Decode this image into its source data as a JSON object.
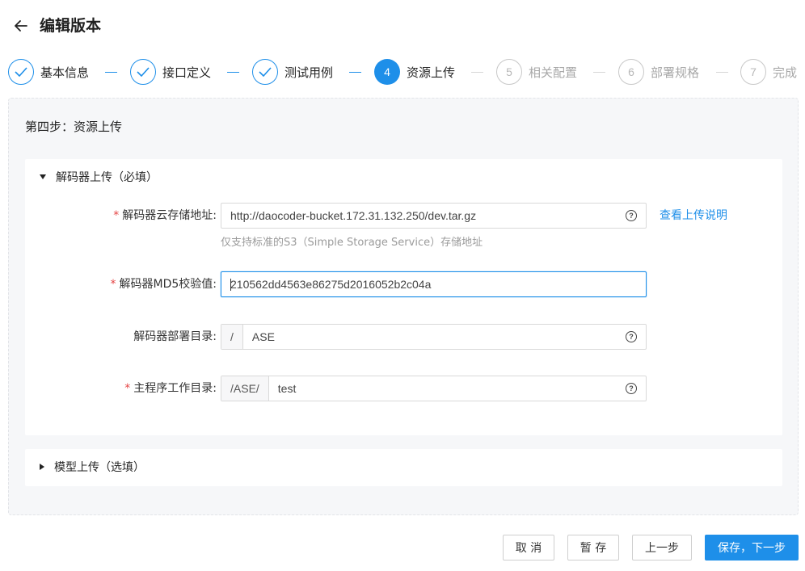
{
  "header": {
    "title": "编辑版本"
  },
  "steps": [
    {
      "number": "1",
      "label": "基本信息",
      "status": "done"
    },
    {
      "number": "2",
      "label": "接口定义",
      "status": "done"
    },
    {
      "number": "3",
      "label": "测试用例",
      "status": "done"
    },
    {
      "number": "4",
      "label": "资源上传",
      "status": "active"
    },
    {
      "number": "5",
      "label": "相关配置",
      "status": "todo"
    },
    {
      "number": "6",
      "label": "部署规格",
      "status": "todo"
    },
    {
      "number": "7",
      "label": "完成",
      "status": "todo"
    }
  ],
  "panel": {
    "title": "第四步：资源上传"
  },
  "decoder_section": {
    "title": "解码器上传（必填）",
    "expanded": true,
    "storage_url": {
      "required_mark": "*",
      "label": "解码器云存储地址:",
      "value": "http://daocoder-bucket.172.31.132.250/dev.tar.gz",
      "hint": "仅支持标准的S3（Simple Storage Service）存储地址",
      "link": "查看上传说明"
    },
    "md5": {
      "required_mark": "*",
      "label": "解码器MD5校验值:",
      "value": "210562dd4563e86275d2016052b2c04a"
    },
    "deploy_dir": {
      "label": "解码器部署目录:",
      "prefix": "/",
      "value": "ASE"
    },
    "work_dir": {
      "required_mark": "*",
      "label": "主程序工作目录:",
      "prefix": "/ASE/",
      "value": "test"
    }
  },
  "model_section": {
    "title": "模型上传（选填）",
    "expanded": false
  },
  "footer": {
    "cancel": "取 消",
    "save_draft": "暂 存",
    "prev": "上一步",
    "save_next": "保存，下一步"
  },
  "colors": {
    "primary": "#1e8fe9",
    "required": "#e54545"
  }
}
